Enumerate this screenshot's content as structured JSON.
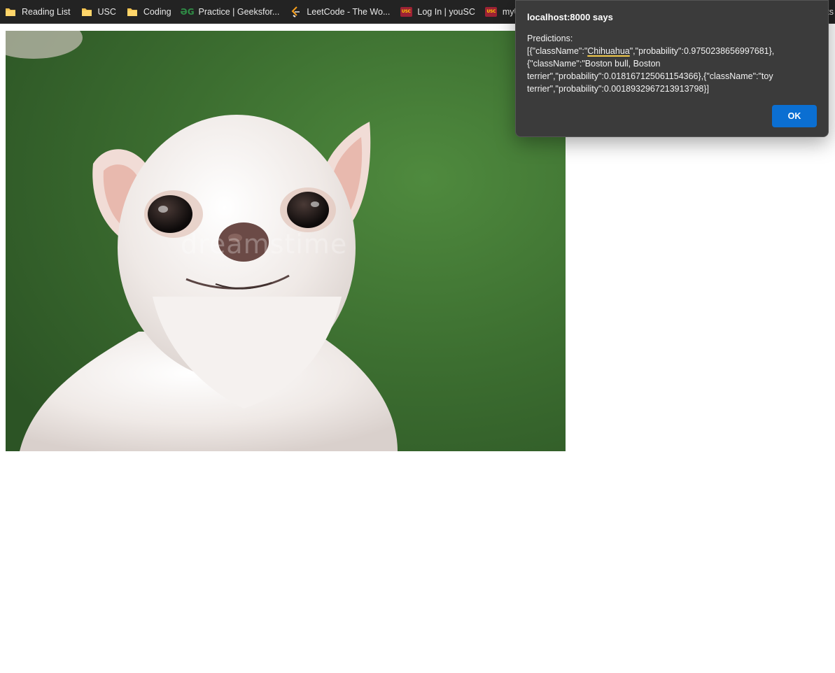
{
  "bookmarks": [
    {
      "label": "Reading List",
      "icon": "folder-icon"
    },
    {
      "label": "USC",
      "icon": "folder-icon"
    },
    {
      "label": "Coding",
      "icon": "folder-icon"
    },
    {
      "label": "Practice | Geeksfor...",
      "icon": "geeksforgeeks-icon"
    },
    {
      "label": "LeetCode - The Wo...",
      "icon": "leetcode-icon"
    },
    {
      "label": "Log In | youSC",
      "icon": "usc-icon"
    },
    {
      "label": "myUSC",
      "icon": "usc-icon"
    }
  ],
  "bookmarks_trailing": "ts",
  "photo": {
    "watermark": "dreamstime"
  },
  "dialog": {
    "title": "localhost:8000 says",
    "message_prefix": "Predictions:\n[{\"className\":\"",
    "message_highlight": "Chihuahua",
    "message_suffix": "\",\"probability\":0.9750238656997681},\n{\"className\":\"Boston bull, Boston terrier\",\"probability\":0.018167125061154366},{\"className\":\"toy terrier\",\"probability\":0.0018932967213913798}]",
    "ok_label": "OK"
  },
  "colors": {
    "dialog_bg": "#3b3b3b",
    "ok_button": "#0b6fd2",
    "highlight_underline": "#f2c94c",
    "bookmarks_bg": "#232323"
  }
}
